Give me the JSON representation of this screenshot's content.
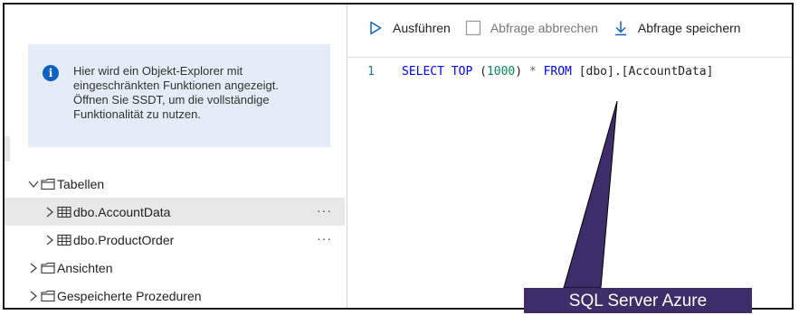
{
  "info_box": {
    "text": "Hier wird ein Objekt-Explorer mit eingeschränkten Funktionen angezeigt. Öffnen Sie SSDT, um die vollständige Funktionalität zu nutzen."
  },
  "tree": {
    "tables_label": "Tabellen",
    "items": [
      {
        "label": "dbo.AccountData",
        "more": "···"
      },
      {
        "label": "dbo.ProductOrder",
        "more": "···"
      }
    ],
    "views_label": "Ansichten",
    "procedures_label": "Gespeicherte Prozeduren"
  },
  "toolbar": {
    "run_label": "Ausführen",
    "cancel_label": "Abfrage abbrechen",
    "save_label": "Abfrage speichern"
  },
  "editor": {
    "line_number": "1",
    "tokens": {
      "select": "SELECT",
      "top": "TOP",
      "paren_open": "(",
      "count": "1000",
      "paren_close": ")",
      "star": "*",
      "from": "FROM",
      "target": "[dbo].[AccountData]"
    }
  },
  "callout": {
    "label": "SQL Server Azure",
    "color": "#3e2d69"
  },
  "colors": {
    "accent": "#0f62c4",
    "info_bg": "#e3ecf7",
    "selected_row": "#e8e8e8",
    "keyword": "#0000ff",
    "number": "#098658"
  }
}
